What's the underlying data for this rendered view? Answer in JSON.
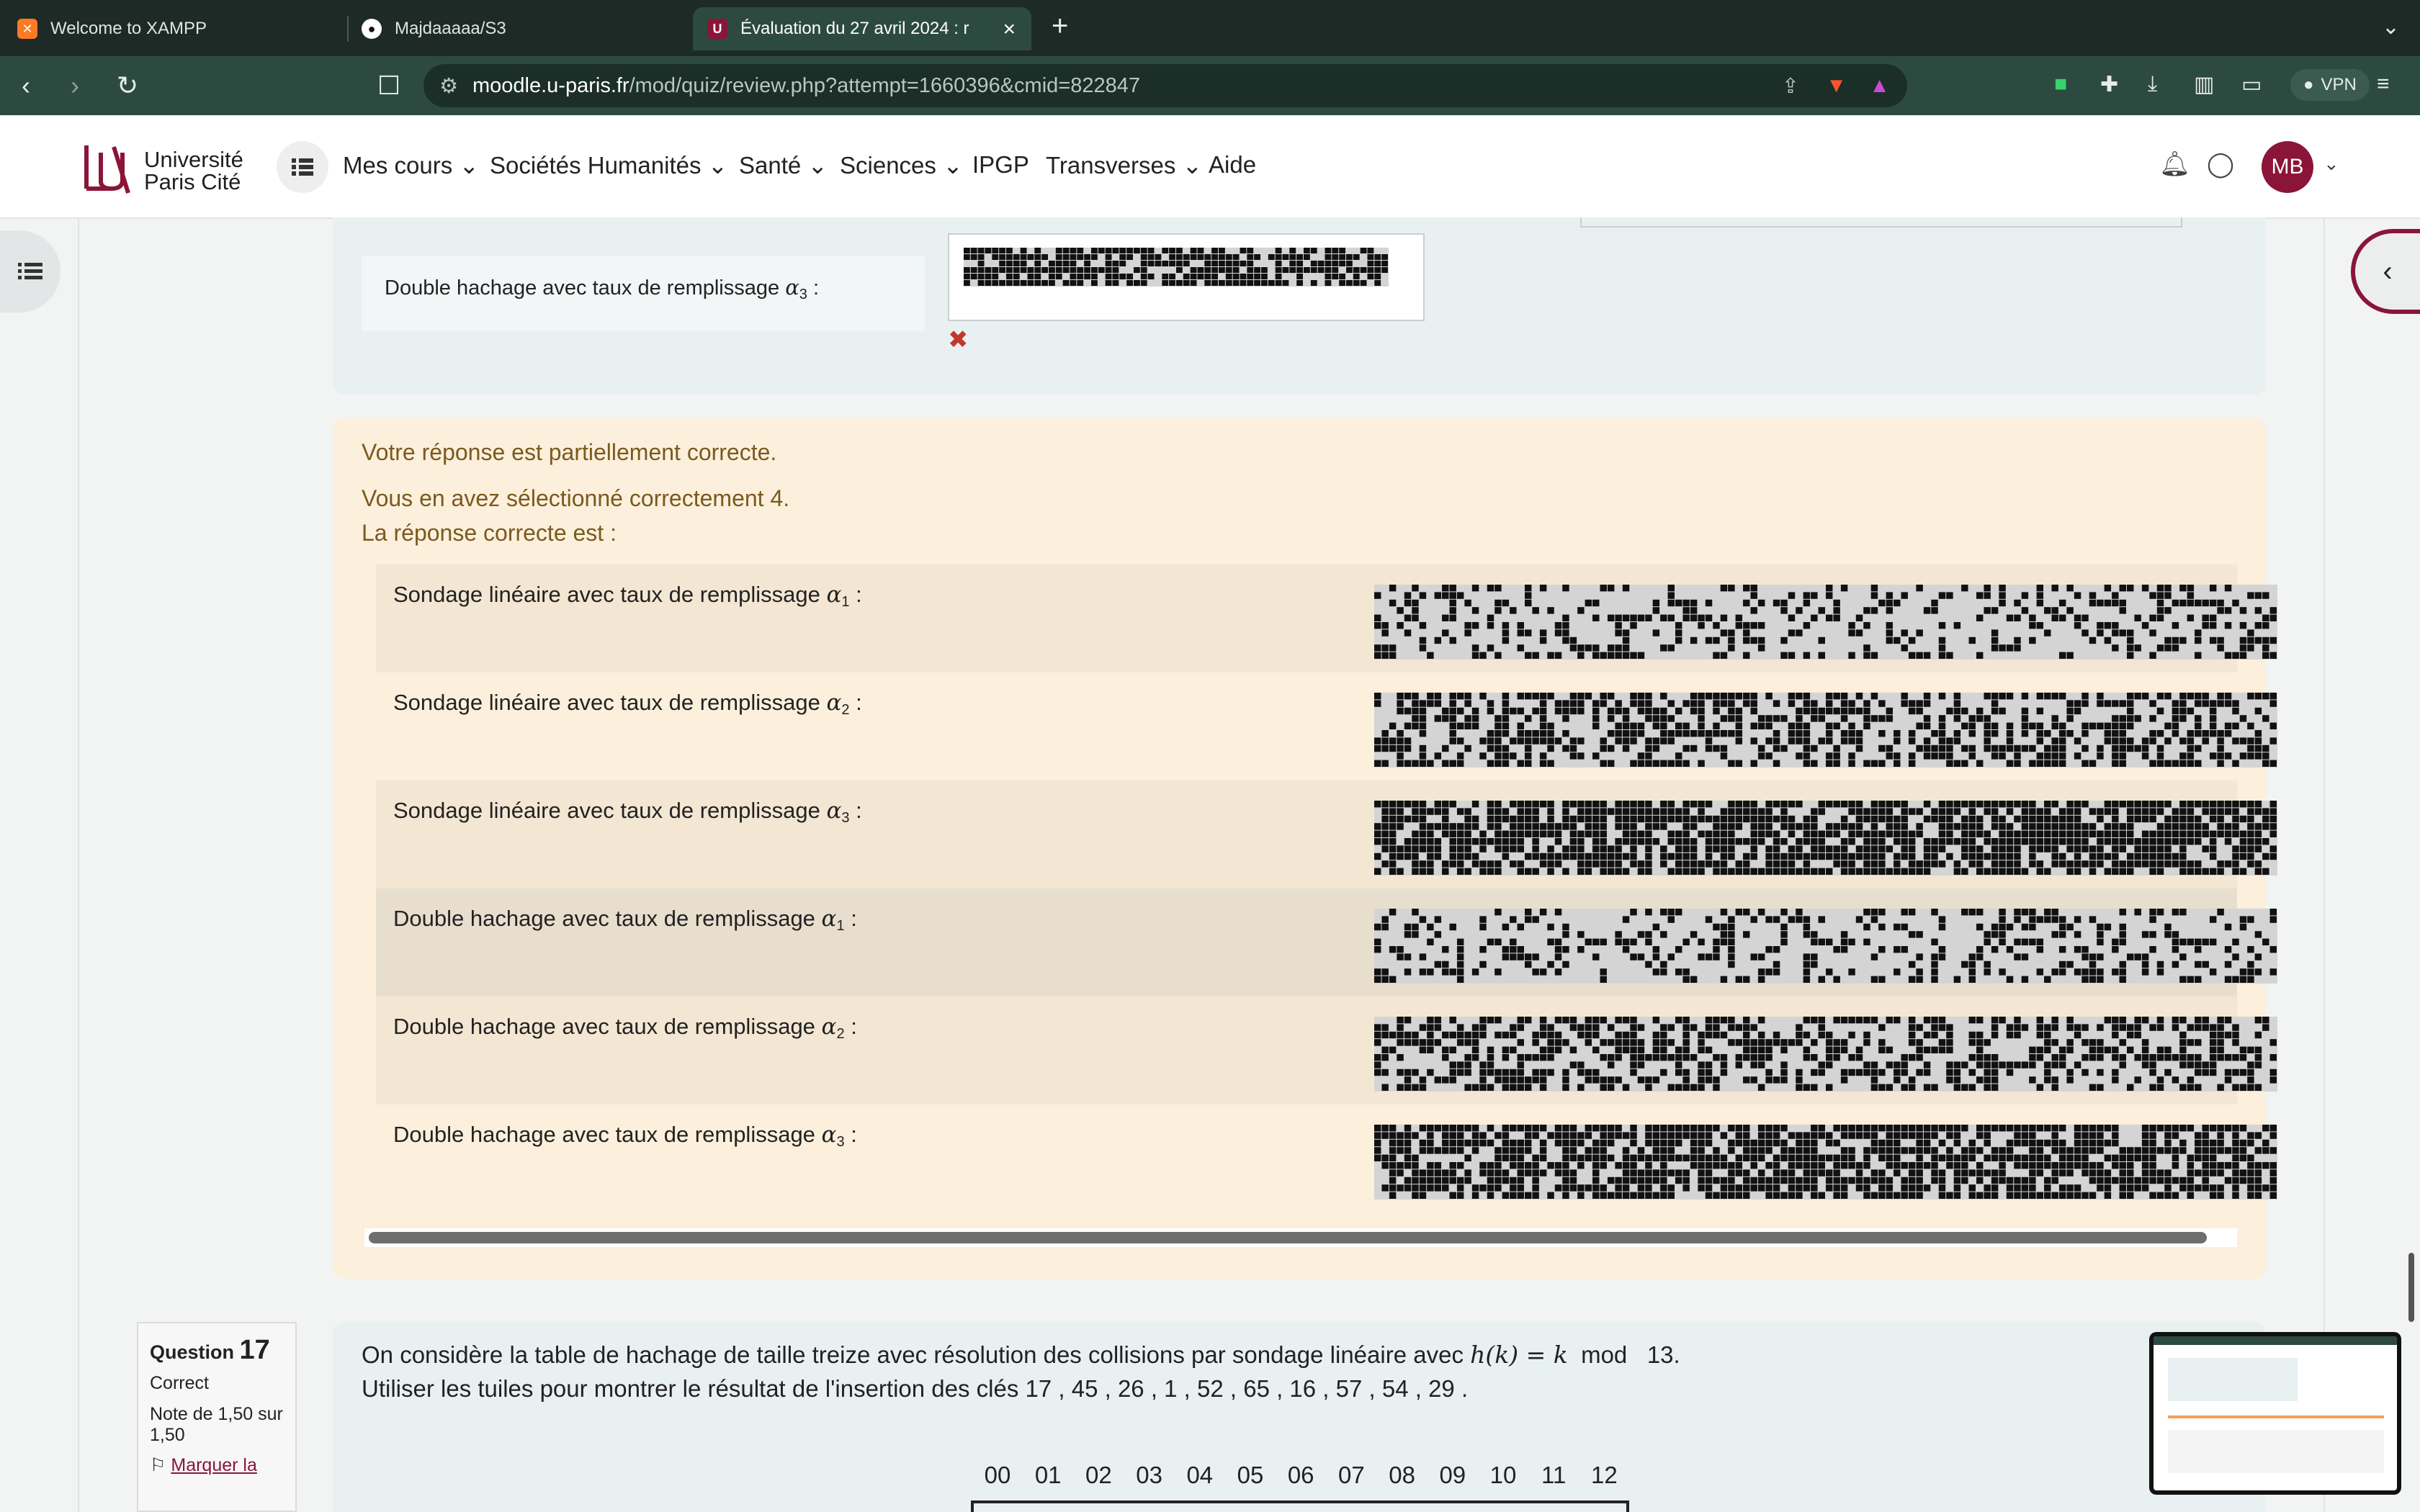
{
  "browser": {
    "tabs": [
      {
        "title": "Welcome to XAMPP",
        "icon": "xampp-icon"
      },
      {
        "title": "Majdaaaaa/S3",
        "icon": "github-icon"
      },
      {
        "title": "Évaluation du 27 avril 2024 : r",
        "icon": "university-icon",
        "active": true
      }
    ],
    "url_host": "moodle.u-paris.fr",
    "url_path": "/mod/quiz/review.php?attempt=1660396&cmid=822847",
    "vpn_label": "VPN"
  },
  "header": {
    "logo_line1": "Université",
    "logo_line2": "Paris Cité",
    "menu": [
      "Mes cours",
      "Sociétés Humanités",
      "Santé",
      "Sciences",
      "IPGP",
      "Transverses",
      "Aide"
    ],
    "avatar_initials": "MB",
    "brand_color": "#8a1538"
  },
  "previous_question": {
    "label_prefix": "Double hachage avec taux de remplissage ",
    "alpha": "α",
    "alpha_index": "3",
    "suffix": " :"
  },
  "feedback": {
    "line1": "Votre réponse est partiellement correcte.",
    "line2": "Vous en avez sélectionné correctement 4.",
    "line3": "La réponse correcte est :",
    "rows": [
      {
        "prefix": "Sondage linéaire avec taux de remplissage ",
        "alpha": "α",
        "index": "1",
        "suffix": " :"
      },
      {
        "prefix": "Sondage linéaire avec taux de remplissage ",
        "alpha": "α",
        "index": "2",
        "suffix": " :"
      },
      {
        "prefix": "Sondage linéaire avec taux de remplissage ",
        "alpha": "α",
        "index": "3",
        "suffix": " :"
      },
      {
        "prefix": "Double hachage avec taux de remplissage ",
        "alpha": "α",
        "index": "1",
        "suffix": " :"
      },
      {
        "prefix": "Double hachage avec taux de remplissage ",
        "alpha": "α",
        "index": "2",
        "suffix": " :"
      },
      {
        "prefix": "Double hachage avec taux de remplissage ",
        "alpha": "α",
        "index": "3",
        "suffix": " :"
      }
    ],
    "fill_levels": [
      0.3,
      0.55,
      0.78,
      0.32,
      0.52,
      0.7
    ],
    "text_color": "#7a5a1e",
    "background": "#fcefdc"
  },
  "question17": {
    "label": "Question",
    "number": "17",
    "status": "Correct",
    "grade": "Note de 1,50 sur 1,50",
    "flag": "Marquer la",
    "text1_before": "On considère la table de hachage de taille treize avec résolution des collisions par sondage linéaire avec ",
    "text1_math": "h(k) = k",
    "text1_mod": "mod",
    "text1_end": "13.",
    "text2": "Utiliser les tuiles pour montrer le résultat de l'insertion des clés  17 ,  45 ,  26 ,  1 ,  52 ,  65 ,  16 ,  57 ,  54 ,  29 .",
    "indices": [
      "00",
      "01",
      "02",
      "03",
      "04",
      "05",
      "06",
      "07",
      "08",
      "09",
      "10",
      "11",
      "12"
    ]
  }
}
